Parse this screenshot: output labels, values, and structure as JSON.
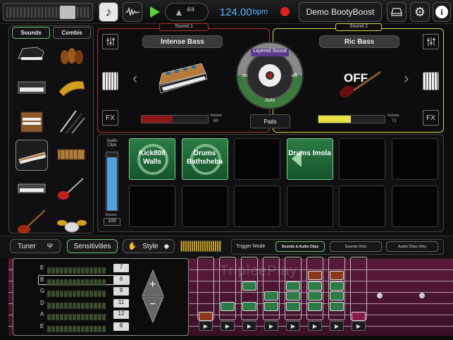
{
  "toolbar": {
    "time_signature": "4/4",
    "tempo_value": "124.00",
    "tempo_unit": "bpm",
    "song_name": "Demo BootyBoost"
  },
  "browser": {
    "tabs": [
      "Sounds",
      "Combis"
    ],
    "selected_tab": "Sounds",
    "instruments": [
      "grand-piano",
      "strings",
      "electric-piano",
      "brass",
      "organ",
      "woodwinds",
      "synth",
      "mallets",
      "keyboard",
      "electric-guitar",
      "bass-guitar",
      "drum-kit"
    ]
  },
  "sound1": {
    "tag": "Sound 1",
    "name": "Intense Bass",
    "volume_label": "Volume",
    "volume": "69",
    "volume_level": 0.69
  },
  "sound2": {
    "tag": "Sound 2",
    "name": "Ric Bass",
    "status": "OFF",
    "volume_label": "Volume",
    "volume": "72",
    "volume_level": 0.72
  },
  "layer": {
    "title": "Layered Sound",
    "on": "on",
    "off": "off",
    "auto": "Auto",
    "pads": "Pads"
  },
  "fx_label": "FX",
  "clips": {
    "label": "Audio Clips",
    "volume_label": "Volume",
    "volume": "100",
    "volume_level": 1.0
  },
  "pads": {
    "p1": "Kick808 Walls",
    "p2": "Drums Bathsheba",
    "p4": "Drums Imola"
  },
  "bottombar": {
    "tuner": "Tuner",
    "sensitivities": "Sensitivities",
    "style": "Style",
    "trigger_mode": "Trigger Mode",
    "trigger_options": [
      "Sounds & Audio Clips",
      "Sounds Only",
      "Audio Clips Only"
    ],
    "selected_trigger": "Sounds & Audio Clips"
  },
  "sensitivity": {
    "strings": [
      {
        "name": "E",
        "value": "7"
      },
      {
        "name": "B",
        "value": "6"
      },
      {
        "name": "G",
        "value": "9"
      },
      {
        "name": "D",
        "value": "11"
      },
      {
        "name": "A",
        "value": "12"
      },
      {
        "name": "E",
        "value": "8"
      }
    ],
    "selected_string": "B",
    "plus": "+",
    "minus": "−"
  },
  "watermark": "TripleePlay",
  "colors": {
    "accent_green": "#6fc178",
    "accent_red": "#c0392b",
    "volume_yellow": "#e8e040",
    "clip_blue": "#4ea3e0",
    "tempo_blue": "#58b6ff"
  }
}
